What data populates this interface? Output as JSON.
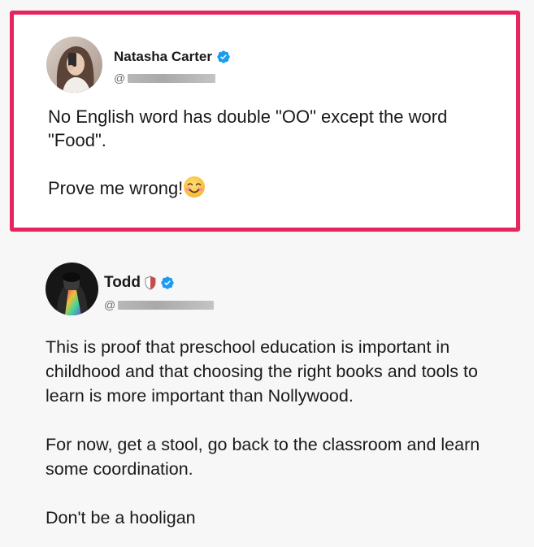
{
  "tweets": [
    {
      "author_name": "Natasha Carter",
      "handle_prefix": "@",
      "verified": true,
      "paragraphs": [
        "No English word has double \"OO\" except the word \"Food\".",
        "Prove me wrong!"
      ],
      "emoji": "smiling-face-with-smiling-eyes",
      "highlight_color": "#e6245e"
    },
    {
      "author_name": "Todd",
      "handle_prefix": "@",
      "verified": true,
      "affiliation_badge": "shield",
      "paragraphs": [
        "This is proof that preschool education is important in childhood and that choosing the right books and tools to learn is more important than Nollywood.",
        "For now, get a stool, go back to the classroom and learn some coordination.",
        "Don't be a hooligan"
      ]
    }
  ],
  "colors": {
    "verified_blue": "#1d9bf0",
    "text": "#1a1a1a",
    "muted": "#6b6f73"
  }
}
